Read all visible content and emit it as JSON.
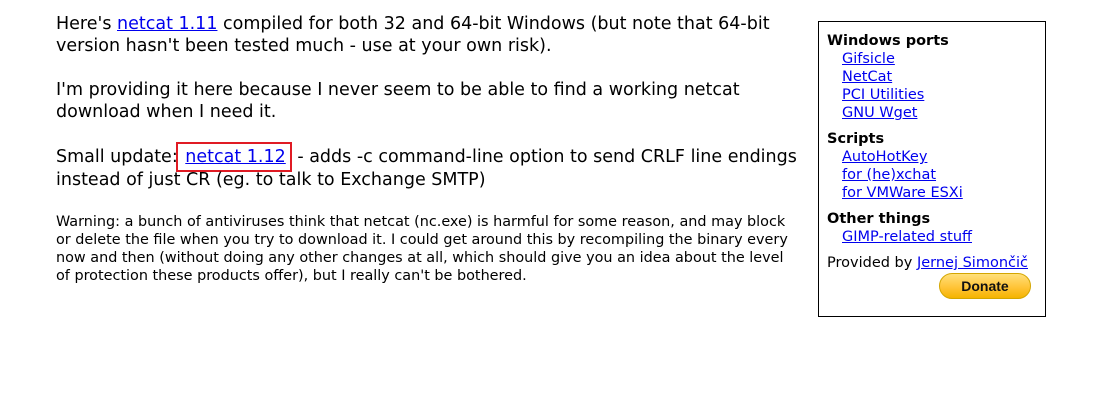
{
  "main": {
    "p1_before": "Here's ",
    "p1_link": "netcat 1.11",
    "p1_after": " compiled for both 32 and 64-bit Windows (but note that 64-bit version hasn't been tested much - use at your own risk).",
    "p2": "I'm providing it here because I never seem to be able to find a working netcat download when I need it.",
    "p3_before": "Small update: ",
    "p3_link": "netcat 1.12",
    "p3_after": " - adds -c command-line option to send CRLF line endings instead of just CR (eg. to talk to Exchange SMTP)",
    "warning": "Warning: a bunch of antiviruses think that netcat (nc.exe) is harmful for some reason, and may block or delete the file when you try to download it. I could get around this by recompiling the binary every now and then (without doing any other changes at all, which should give you an idea about the level of protection these products offer), but I really can't be bothered."
  },
  "sidebar": {
    "sections": [
      {
        "title": "Windows ports",
        "links": [
          "Gifsicle",
          "NetCat",
          "PCI Utilities",
          "GNU Wget"
        ]
      },
      {
        "title": "Scripts",
        "links": [
          "AutoHotKey",
          "for (he)xchat",
          "for VMWare ESXi"
        ]
      },
      {
        "title": "Other things",
        "links": [
          "GIMP-related stuff"
        ]
      }
    ],
    "provided_by": "Provided by ",
    "author": "Jernej Simončič",
    "donate_label": "Donate"
  },
  "colors": {
    "link": "#0000ee",
    "highlight_box": "#e01b24",
    "donate_button": "#ffc439"
  }
}
